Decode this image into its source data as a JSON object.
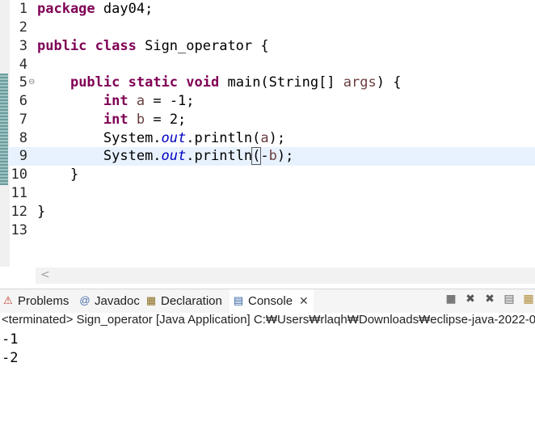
{
  "editor": {
    "line_numbers": [
      "1",
      "2",
      "3",
      "4",
      "5",
      "6",
      "7",
      "8",
      "9",
      "10",
      "11",
      "12",
      "13"
    ],
    "fold_marker": "⊖",
    "lines": {
      "l1": {
        "kw": "package",
        "rest": " day04;"
      },
      "l3": {
        "kw1": "public",
        "kw2": "class",
        "rest": " Sign_operator {"
      },
      "l5": {
        "kw1": "public",
        "kw2": "static",
        "kw3": "void",
        "rest1": " main(String[] ",
        "param": "args",
        "rest2": ") {"
      },
      "l6": {
        "kw": "int",
        "var": "a",
        "rest": " = -1;"
      },
      "l7": {
        "kw": "int",
        "var": "b",
        "rest": " = 2;"
      },
      "l8": {
        "pre": "System.",
        "fld": "out",
        "mid": ".println(",
        "var": "a",
        "post": ");"
      },
      "l9": {
        "pre": "System.",
        "fld": "out",
        "mid": ".println",
        "open": "(",
        "minus": "-",
        "var": "b",
        "post": ");"
      },
      "l10": {
        "rest": "}"
      },
      "l12": {
        "rest": "}"
      }
    },
    "scroll_left": "<"
  },
  "panel": {
    "tabs": [
      {
        "label": "Problems",
        "icon": "problems-icon"
      },
      {
        "label": "Javadoc",
        "icon": "javadoc-icon"
      },
      {
        "label": "Declaration",
        "icon": "declaration-icon"
      },
      {
        "label": "Console",
        "icon": "console-icon"
      }
    ],
    "close_glyph": "✕",
    "status": "<terminated> Sign_operator [Java Application] C:₩Users₩rlaqh₩Downloads₩eclipse-java-2022-0",
    "output": [
      "-1",
      "-2"
    ]
  },
  "colors": {
    "keyword": "#7f0055",
    "field": "#0000c0",
    "variable": "#6a3e3e",
    "current_line": "#e8f2fe"
  }
}
